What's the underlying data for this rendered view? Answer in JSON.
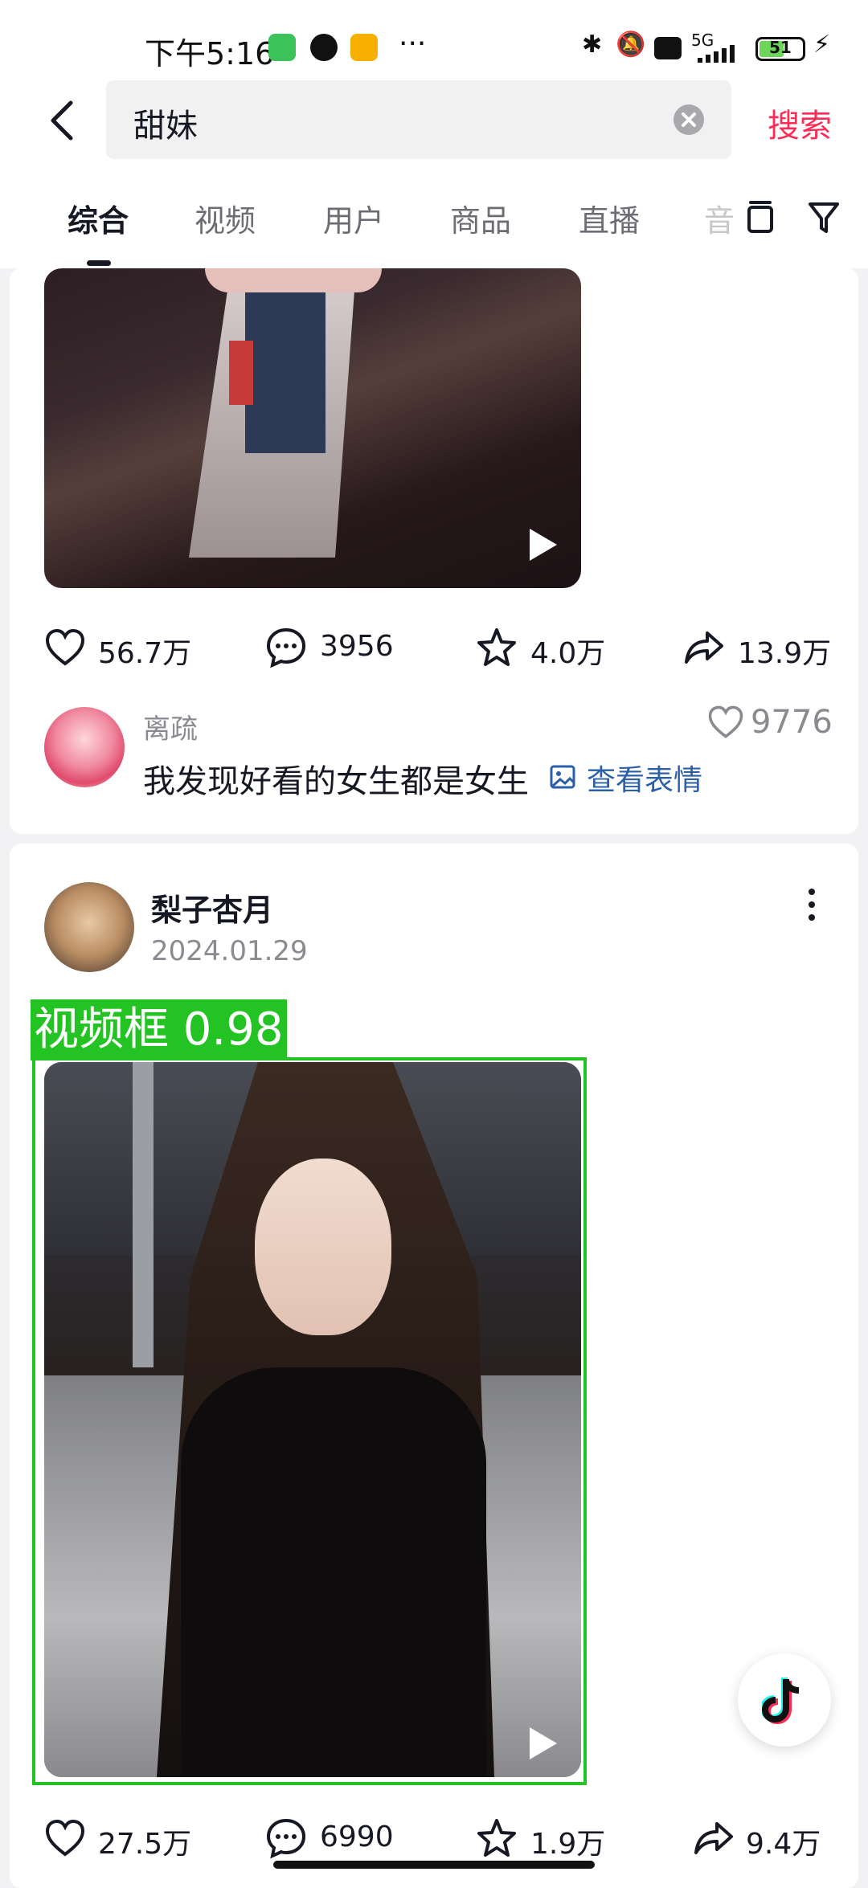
{
  "status_bar": {
    "time": "下午5:16",
    "more_dots": "···",
    "network": "5G",
    "battery": "51"
  },
  "header": {
    "search_value": "甜妹",
    "search_button": "搜索"
  },
  "tabs": [
    {
      "label": "综合",
      "active": true
    },
    {
      "label": "视频",
      "active": false
    },
    {
      "label": "用户",
      "active": false
    },
    {
      "label": "商品",
      "active": false
    },
    {
      "label": "直播",
      "active": false
    },
    {
      "label": "音",
      "active": false
    }
  ],
  "post1": {
    "stats": {
      "likes": "56.7万",
      "comments": "3956",
      "favorites": "4.0万",
      "shares": "13.9万"
    },
    "comment": {
      "user": "离疏",
      "text": "我发现好看的女生都是女生",
      "sticker_link": "查看表情",
      "likes": "9776"
    }
  },
  "post2": {
    "author": "梨子杏月",
    "date": "2024.01.29",
    "stats": {
      "likes": "27.5万",
      "comments": "6990",
      "favorites": "1.9万",
      "shares": "9.4万"
    }
  },
  "detection": {
    "label": "视频框 0.98",
    "color": "#22c322"
  },
  "colors": {
    "accent": "#fe2c55",
    "link": "#2b5fa8"
  }
}
